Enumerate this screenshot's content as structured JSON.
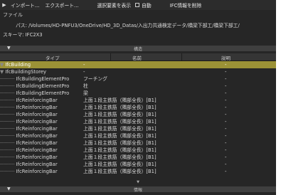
{
  "toolbar": {
    "import_label": "インポート...",
    "export_label": "エクスポート...",
    "show_selected_label": "選択要素を表示",
    "auto_label": "自動",
    "delete_ifc_label": "IFC情報を削除"
  },
  "file": {
    "section_label": "ファイル",
    "path_label": "パス:",
    "path_value": "/Volumes/HD-PNFU3/OneDrive/HD_3D_Datas/入出力共通検定データ/橋梁下部工/橋梁下部工/",
    "schema_label": "スキーマ:",
    "schema_value": "IFC2X3"
  },
  "structure_section": {
    "title": "構造"
  },
  "columns": {
    "type": "タイプ",
    "name": "名前",
    "description": "説明"
  },
  "rows": [
    {
      "type": "IfcBuilding",
      "name": "-",
      "description": "-",
      "selected": true
    },
    {
      "type": "IfcBuildingStorey",
      "name": "-",
      "description": "-"
    },
    {
      "type": "IfcBuildingElementPro",
      "name": "フーチング",
      "description": "-"
    },
    {
      "type": "IfcBuildingElementPro",
      "name": "柱",
      "description": "-"
    },
    {
      "type": "IfcBuildingElementPro",
      "name": "梁",
      "description": "-"
    },
    {
      "type": "IfcReinforcingBar",
      "name": "上面１段主鉄筋（隅部全長）[B1]",
      "description": "-"
    },
    {
      "type": "IfcReinforcingBar",
      "name": "上面１段主鉄筋（隅部全長）[B1]",
      "description": "-"
    },
    {
      "type": "IfcReinforcingBar",
      "name": "上面１段主鉄筋（隅部全長）[B1]",
      "description": "-"
    },
    {
      "type": "IfcReinforcingBar",
      "name": "上面１段主鉄筋（隅部全長）[B1]",
      "description": "-"
    },
    {
      "type": "IfcReinforcingBar",
      "name": "上面１段主鉄筋（隅部全長）[B1]",
      "description": "-"
    },
    {
      "type": "IfcReinforcingBar",
      "name": "上面１段主鉄筋（隅部全長）[B1]",
      "description": "-"
    },
    {
      "type": "IfcReinforcingBar",
      "name": "上面１段主鉄筋（隅部全長）[B1]",
      "description": "-"
    },
    {
      "type": "IfcReinforcingBar",
      "name": "上面１段主鉄筋（隅部全長）[B1]",
      "description": "-"
    },
    {
      "type": "IfcReinforcingBar",
      "name": "上面１段主鉄筋（隅部全長）[B1]",
      "description": "-"
    },
    {
      "type": "IfcReinforcingBar",
      "name": "上面１段主鉄筋（隅部全長）[B1]",
      "description": "-"
    },
    {
      "type": "IfcReinforcingBar",
      "name": "上面１段主鉄筋（隅部全長）[B1]",
      "description": "-"
    }
  ],
  "info_section": {
    "title": "情報"
  },
  "icons": {
    "play": "play-icon",
    "disclosure": "disclosure-triangle-icon",
    "scroll_more": "scroll-down-icon"
  },
  "colors": {
    "panel_bg": "#262626",
    "selected_row": "#9b9236",
    "section_bar": "#3f3f3f"
  }
}
